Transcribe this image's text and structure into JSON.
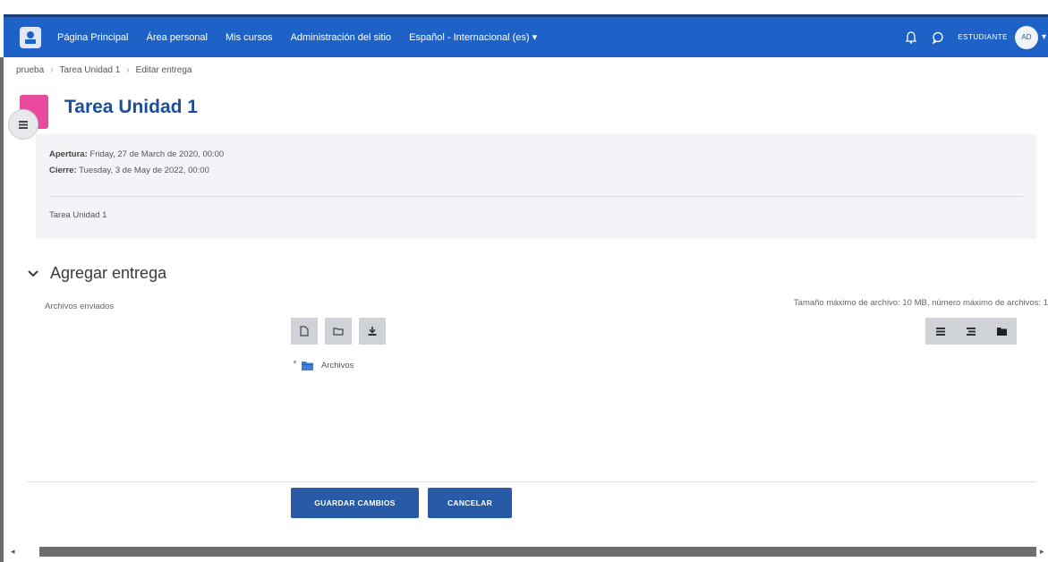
{
  "navbar": {
    "links": [
      "Página Principal",
      "Área personal",
      "Mis cursos",
      "Administración del sitio",
      "Español - Internacional (es) ▾"
    ],
    "user_role": "ESTUDIANTE",
    "avatar_initials": "AD",
    "user_caret": "▾",
    "color": "#1e62c8"
  },
  "breadcrumb": [
    "prueba",
    "Tarea Unidad 1",
    "Editar entrega"
  ],
  "breadcrumb_separator": "›",
  "page_title": "Tarea Unidad 1",
  "dates": {
    "opening_label": "Apertura:",
    "opening_value": " Friday, 27 de March de 2020, 00:00",
    "closing_label": "Cierre:",
    "closing_value": " Tuesday, 3 de May de 2022, 00:00"
  },
  "description": "Tarea Unidad 1",
  "section_title": "Agregar entrega",
  "files_label": "Archivos enviados",
  "max_info": "Tamaño máximo de archivo: 10 MB, número máximo de archivos: 1",
  "filepicker": {
    "left_icons": [
      "add-file-icon",
      "create-folder-icon",
      "download-icon"
    ],
    "right_icons": [
      "icon-view-icon",
      "list-view-icon",
      "tree-view-icon"
    ]
  },
  "folder_label": "Archivos",
  "buttons": {
    "save": "GUARDAR CAMBIOS",
    "cancel": "CANCELAR"
  }
}
